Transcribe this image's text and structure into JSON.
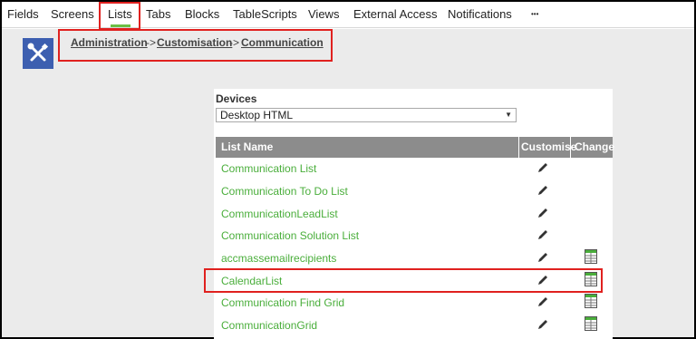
{
  "nav": {
    "tabs": [
      "Fields",
      "Screens",
      "Lists",
      "Tabs",
      "Blocks",
      "TableScripts",
      "Views",
      "External Access",
      "Notifications",
      "•••"
    ],
    "active_tab": "Lists"
  },
  "breadcrumb": {
    "items": [
      "Administration",
      "Customisation",
      "Communication"
    ],
    "separator": "->"
  },
  "devices": {
    "label": "Devices",
    "selected": "Desktop HTML"
  },
  "table": {
    "columns": [
      "List Name",
      "Customise",
      "Change"
    ],
    "rows": [
      {
        "name": "Communication List",
        "has_change_icon": false
      },
      {
        "name": "Communication To Do List",
        "has_change_icon": false
      },
      {
        "name": "CommunicationLeadList",
        "has_change_icon": false
      },
      {
        "name": "Communication Solution List",
        "has_change_icon": false
      },
      {
        "name": "accmassemailrecipients",
        "has_change_icon": true
      },
      {
        "name": "CalendarList",
        "has_change_icon": true
      },
      {
        "name": "Communication Find Grid",
        "has_change_icon": true
      },
      {
        "name": "CommunicationGrid",
        "has_change_icon": true
      }
    ]
  },
  "icons": {
    "app": "tools-icon",
    "customise": "pencil-icon",
    "change": "grid-icon"
  },
  "colors": {
    "accent_green": "#4aae3b",
    "highlight_red": "#e0211f",
    "icon_blue": "#3d5fb0",
    "header_gray": "#8c8c8c"
  }
}
